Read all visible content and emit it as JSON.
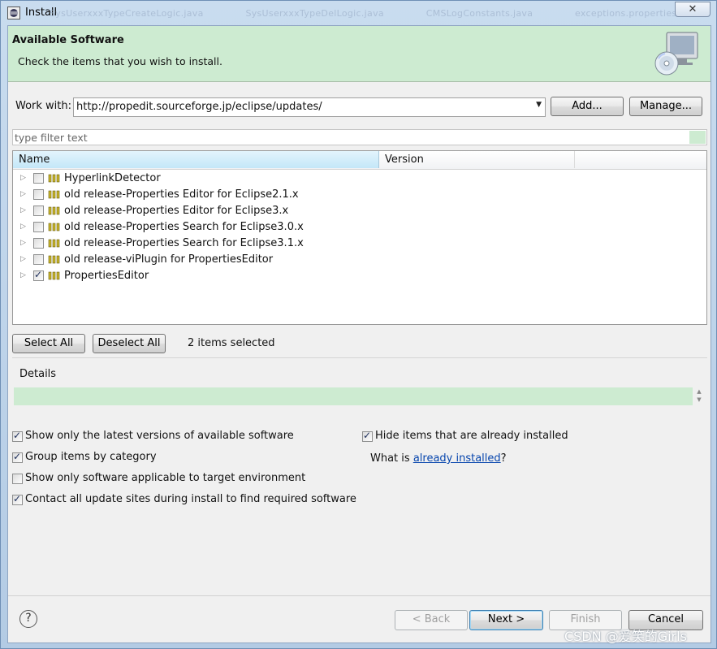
{
  "window": {
    "title": "Install",
    "background_tabs": [
      "SysUserxxxTypeCreateLogic.java",
      "SysUserxxxTypeDelLogic.java",
      "CMSLogConstants.java",
      "exceptions.properties"
    ],
    "close_glyph": "✕"
  },
  "banner": {
    "title": "Available Software",
    "subtitle": "Check the items that you wish to install.",
    "icon": "install-cd-monitor-icon",
    "color": "#cdebd1"
  },
  "work_with": {
    "label": "Work with:",
    "value": "http://propedit.sourceforge.jp/eclipse/updates/",
    "add_label": "Add...",
    "manage_label": "Manage..."
  },
  "filter": {
    "placeholder": "type filter text"
  },
  "tree": {
    "columns": [
      "Name",
      "Version"
    ],
    "items": [
      {
        "label": "HyperlinkDetector",
        "checked": false
      },
      {
        "label": "old release-Properties Editor for Eclipse2.1.x",
        "checked": false
      },
      {
        "label": "old release-Properties Editor for Eclipse3.x",
        "checked": false
      },
      {
        "label": "old release-Properties Search for Eclipse3.0.x",
        "checked": false
      },
      {
        "label": "old release-Properties Search for Eclipse3.1.x",
        "checked": false
      },
      {
        "label": "old release-viPlugin for PropertiesEditor",
        "checked": false
      },
      {
        "label": "PropertiesEditor",
        "checked": true
      }
    ]
  },
  "selection": {
    "select_all": "Select All",
    "deselect_all": "Deselect All",
    "status": "2 items selected"
  },
  "details": {
    "label": "Details"
  },
  "options": {
    "latest_versions": {
      "label": "Show only the latest versions of available software",
      "checked": true
    },
    "group_by_category": {
      "label": "Group items by category",
      "checked": true
    },
    "applicable_only": {
      "label": "Show only software applicable to target environment",
      "checked": false
    },
    "contact_all_sites": {
      "label": "Contact all update sites during install to find required software",
      "checked": true
    },
    "hide_installed": {
      "label": "Hide items that are already installed",
      "checked": true
    },
    "what_is_prefix": "What is ",
    "what_is_link": "already installed",
    "what_is_suffix": "?"
  },
  "footer": {
    "help": "?",
    "back": "< Back",
    "next": "Next >",
    "finish": "Finish",
    "cancel": "Cancel"
  },
  "watermark": "CSDN @爱笑的Girls",
  "colors": {
    "accent_green": "#cdebd1",
    "link": "#0645ad",
    "header_selected": "#c4e7f8"
  }
}
